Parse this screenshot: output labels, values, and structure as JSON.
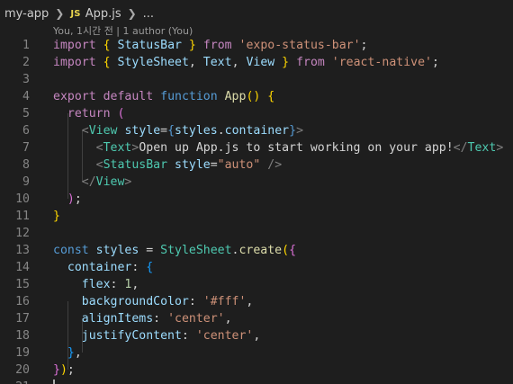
{
  "breadcrumb": {
    "folder": "my-app",
    "file_badge": "JS",
    "file": "App.js",
    "more": "..."
  },
  "codelens": "You, 1시간 전 | 1 author (You)",
  "colors": {
    "background": "#1e1e1e",
    "keyword": "#c586c0",
    "storage": "#569cd6",
    "string": "#ce9178",
    "type": "#4ec9b0",
    "function": "#dcdcaa",
    "variable": "#9cdcfe",
    "number": "#b5cea8"
  },
  "lines": [
    {
      "num": "1",
      "tokens": [
        {
          "t": "import",
          "c": "kw"
        },
        {
          "t": " ",
          "c": "plain"
        },
        {
          "t": "{",
          "c": "b1"
        },
        {
          "t": " ",
          "c": "plain"
        },
        {
          "t": "StatusBar",
          "c": "var"
        },
        {
          "t": " ",
          "c": "plain"
        },
        {
          "t": "}",
          "c": "b1"
        },
        {
          "t": " ",
          "c": "plain"
        },
        {
          "t": "from",
          "c": "kw"
        },
        {
          "t": " ",
          "c": "plain"
        },
        {
          "t": "'expo-status-bar'",
          "c": "str"
        },
        {
          "t": ";",
          "c": "plain"
        }
      ]
    },
    {
      "num": "2",
      "tokens": [
        {
          "t": "import",
          "c": "kw"
        },
        {
          "t": " ",
          "c": "plain"
        },
        {
          "t": "{",
          "c": "b1"
        },
        {
          "t": " ",
          "c": "plain"
        },
        {
          "t": "StyleSheet",
          "c": "var"
        },
        {
          "t": ", ",
          "c": "plain"
        },
        {
          "t": "Text",
          "c": "var"
        },
        {
          "t": ", ",
          "c": "plain"
        },
        {
          "t": "View",
          "c": "var"
        },
        {
          "t": " ",
          "c": "plain"
        },
        {
          "t": "}",
          "c": "b1"
        },
        {
          "t": " ",
          "c": "plain"
        },
        {
          "t": "from",
          "c": "kw"
        },
        {
          "t": " ",
          "c": "plain"
        },
        {
          "t": "'react-native'",
          "c": "str"
        },
        {
          "t": ";",
          "c": "plain"
        }
      ]
    },
    {
      "num": "3",
      "tokens": []
    },
    {
      "num": "4",
      "tokens": [
        {
          "t": "export",
          "c": "kw"
        },
        {
          "t": " ",
          "c": "plain"
        },
        {
          "t": "default",
          "c": "kw"
        },
        {
          "t": " ",
          "c": "plain"
        },
        {
          "t": "function",
          "c": "kw2"
        },
        {
          "t": " ",
          "c": "plain"
        },
        {
          "t": "App",
          "c": "fn"
        },
        {
          "t": "()",
          "c": "b1"
        },
        {
          "t": " ",
          "c": "plain"
        },
        {
          "t": "{",
          "c": "b1"
        }
      ]
    },
    {
      "num": "5",
      "tokens": [
        {
          "t": "  ",
          "c": "plain"
        },
        {
          "t": "return",
          "c": "kw"
        },
        {
          "t": " ",
          "c": "plain"
        },
        {
          "t": "(",
          "c": "b2"
        }
      ]
    },
    {
      "num": "6",
      "tokens": [
        {
          "t": "    ",
          "c": "plain"
        },
        {
          "t": "<",
          "c": "tag"
        },
        {
          "t": "View",
          "c": "cls"
        },
        {
          "t": " ",
          "c": "plain"
        },
        {
          "t": "style",
          "c": "var"
        },
        {
          "t": "=",
          "c": "plain"
        },
        {
          "t": "{",
          "c": "kw2"
        },
        {
          "t": "styles",
          "c": "var"
        },
        {
          "t": ".",
          "c": "plain"
        },
        {
          "t": "container",
          "c": "var"
        },
        {
          "t": "}",
          "c": "kw2"
        },
        {
          "t": ">",
          "c": "tag"
        }
      ]
    },
    {
      "num": "7",
      "tokens": [
        {
          "t": "      ",
          "c": "plain"
        },
        {
          "t": "<",
          "c": "tag"
        },
        {
          "t": "Text",
          "c": "cls"
        },
        {
          "t": ">",
          "c": "tag"
        },
        {
          "t": "Open up App.js to start working on your app!",
          "c": "plain"
        },
        {
          "t": "</",
          "c": "tag"
        },
        {
          "t": "Text",
          "c": "cls"
        },
        {
          "t": ">",
          "c": "tag"
        }
      ]
    },
    {
      "num": "8",
      "tokens": [
        {
          "t": "      ",
          "c": "plain"
        },
        {
          "t": "<",
          "c": "tag"
        },
        {
          "t": "StatusBar",
          "c": "cls"
        },
        {
          "t": " ",
          "c": "plain"
        },
        {
          "t": "style",
          "c": "var"
        },
        {
          "t": "=",
          "c": "plain"
        },
        {
          "t": "\"auto\"",
          "c": "str"
        },
        {
          "t": " ",
          "c": "plain"
        },
        {
          "t": "/>",
          "c": "tag"
        }
      ]
    },
    {
      "num": "9",
      "tokens": [
        {
          "t": "    ",
          "c": "plain"
        },
        {
          "t": "</",
          "c": "tag"
        },
        {
          "t": "View",
          "c": "cls"
        },
        {
          "t": ">",
          "c": "tag"
        }
      ]
    },
    {
      "num": "10",
      "tokens": [
        {
          "t": "  ",
          "c": "plain"
        },
        {
          "t": ")",
          "c": "b2"
        },
        {
          "t": ";",
          "c": "plain"
        }
      ]
    },
    {
      "num": "11",
      "tokens": [
        {
          "t": "}",
          "c": "b1"
        }
      ]
    },
    {
      "num": "12",
      "tokens": []
    },
    {
      "num": "13",
      "tokens": [
        {
          "t": "const",
          "c": "kw2"
        },
        {
          "t": " ",
          "c": "plain"
        },
        {
          "t": "styles",
          "c": "var"
        },
        {
          "t": " = ",
          "c": "plain"
        },
        {
          "t": "StyleSheet",
          "c": "cls"
        },
        {
          "t": ".",
          "c": "plain"
        },
        {
          "t": "create",
          "c": "fn"
        },
        {
          "t": "(",
          "c": "b1"
        },
        {
          "t": "{",
          "c": "b2"
        }
      ]
    },
    {
      "num": "14",
      "tokens": [
        {
          "t": "  ",
          "c": "plain"
        },
        {
          "t": "container",
          "c": "var"
        },
        {
          "t": ": ",
          "c": "plain"
        },
        {
          "t": "{",
          "c": "b3"
        }
      ]
    },
    {
      "num": "15",
      "tokens": [
        {
          "t": "    ",
          "c": "plain"
        },
        {
          "t": "flex",
          "c": "var"
        },
        {
          "t": ": ",
          "c": "plain"
        },
        {
          "t": "1",
          "c": "num"
        },
        {
          "t": ",",
          "c": "plain"
        }
      ]
    },
    {
      "num": "16",
      "tokens": [
        {
          "t": "    ",
          "c": "plain"
        },
        {
          "t": "backgroundColor",
          "c": "var"
        },
        {
          "t": ": ",
          "c": "plain"
        },
        {
          "t": "'#fff'",
          "c": "str"
        },
        {
          "t": ",",
          "c": "plain"
        }
      ]
    },
    {
      "num": "17",
      "tokens": [
        {
          "t": "    ",
          "c": "plain"
        },
        {
          "t": "alignItems",
          "c": "var"
        },
        {
          "t": ": ",
          "c": "plain"
        },
        {
          "t": "'center'",
          "c": "str"
        },
        {
          "t": ",",
          "c": "plain"
        }
      ]
    },
    {
      "num": "18",
      "tokens": [
        {
          "t": "    ",
          "c": "plain"
        },
        {
          "t": "justifyContent",
          "c": "var"
        },
        {
          "t": ": ",
          "c": "plain"
        },
        {
          "t": "'center'",
          "c": "str"
        },
        {
          "t": ",",
          "c": "plain"
        }
      ]
    },
    {
      "num": "19",
      "tokens": [
        {
          "t": "  ",
          "c": "plain"
        },
        {
          "t": "}",
          "c": "b3"
        },
        {
          "t": ",",
          "c": "plain"
        }
      ]
    },
    {
      "num": "20",
      "tokens": [
        {
          "t": "}",
          "c": "b2"
        },
        {
          "t": ")",
          "c": "b1"
        },
        {
          "t": ";",
          "c": "plain"
        }
      ]
    },
    {
      "num": "21",
      "tokens": []
    }
  ]
}
